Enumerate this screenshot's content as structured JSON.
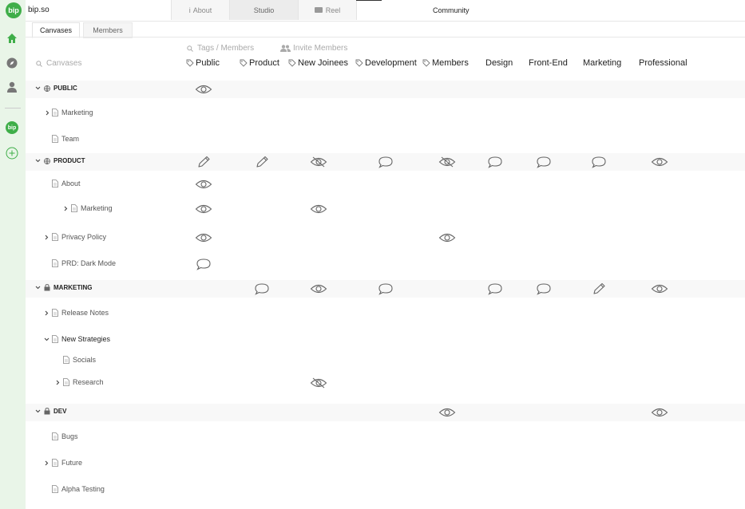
{
  "brand": {
    "logo_text": "bip",
    "name": "bip.so"
  },
  "top_tabs": [
    {
      "label": "About",
      "icon": "info-icon"
    },
    {
      "label": "Studio"
    },
    {
      "label": "Reel",
      "icon": "film-icon"
    }
  ],
  "community_label": "Community",
  "sub_tabs": [
    "Canvases",
    "Members"
  ],
  "search": {
    "placeholder": "Canvases"
  },
  "tags_placeholder": "Tags / Members",
  "invite_label": "Invite Members",
  "columns": [
    "Public",
    "Product",
    "New Joinees",
    "Development",
    "Members",
    "Design",
    "Front-End",
    "Marketing",
    "Professional"
  ],
  "rows": [
    {
      "label": "PUBLIC",
      "type": "group",
      "lock": "globe",
      "perms": [
        "view",
        "",
        "",
        "",
        "",
        "",
        "",
        "",
        ""
      ]
    },
    {
      "label": "Marketing",
      "type": "item",
      "expand": true,
      "perms": []
    },
    {
      "label": "Team",
      "type": "item",
      "expand": false,
      "perms": []
    },
    {
      "label": "PRODUCT",
      "type": "group",
      "lock": "globe",
      "perms": [
        "edit",
        "edit",
        "hidden",
        "comment",
        "hidden",
        "comment",
        "comment",
        "comment",
        "view"
      ]
    },
    {
      "label": "About",
      "type": "item",
      "expand": false,
      "perms": [
        "view"
      ]
    },
    {
      "label": "Marketing",
      "type": "item",
      "expand": true,
      "perms": [
        "view",
        "",
        "view"
      ]
    },
    {
      "label": "Privacy Policy",
      "type": "item",
      "expand": true,
      "perms": [
        "view",
        "",
        "",
        "",
        "view"
      ]
    },
    {
      "label": "PRD: Dark Mode",
      "type": "item",
      "expand": false,
      "perms": [
        "comment"
      ]
    },
    {
      "label": "MARKETING",
      "type": "group",
      "lock": "lock",
      "perms": [
        "",
        "comment",
        "view",
        "comment",
        "",
        "comment",
        "comment",
        "edit",
        "view"
      ]
    },
    {
      "label": "Release Notes",
      "type": "item",
      "expand": true,
      "perms": []
    },
    {
      "label": "New Strategies",
      "type": "item",
      "expand": true,
      "perms": []
    },
    {
      "label": "Socials",
      "type": "item",
      "expand": false,
      "perms": []
    },
    {
      "label": "Research",
      "type": "item",
      "expand": true,
      "perms": [
        "",
        "",
        "hidden"
      ]
    },
    {
      "label": "DEV",
      "type": "group",
      "lock": "lock",
      "perms": [
        "",
        "",
        "",
        "",
        "view",
        "",
        "",
        "",
        "view"
      ]
    },
    {
      "label": "Bugs",
      "type": "item",
      "expand": false,
      "perms": []
    },
    {
      "label": "Future",
      "type": "item",
      "expand": true,
      "perms": []
    },
    {
      "label": "Alpha Testing",
      "type": "item",
      "expand": false,
      "perms": []
    }
  ],
  "colors": {
    "accent": "#3fae49",
    "rail_bg": "#e9f5e8"
  }
}
